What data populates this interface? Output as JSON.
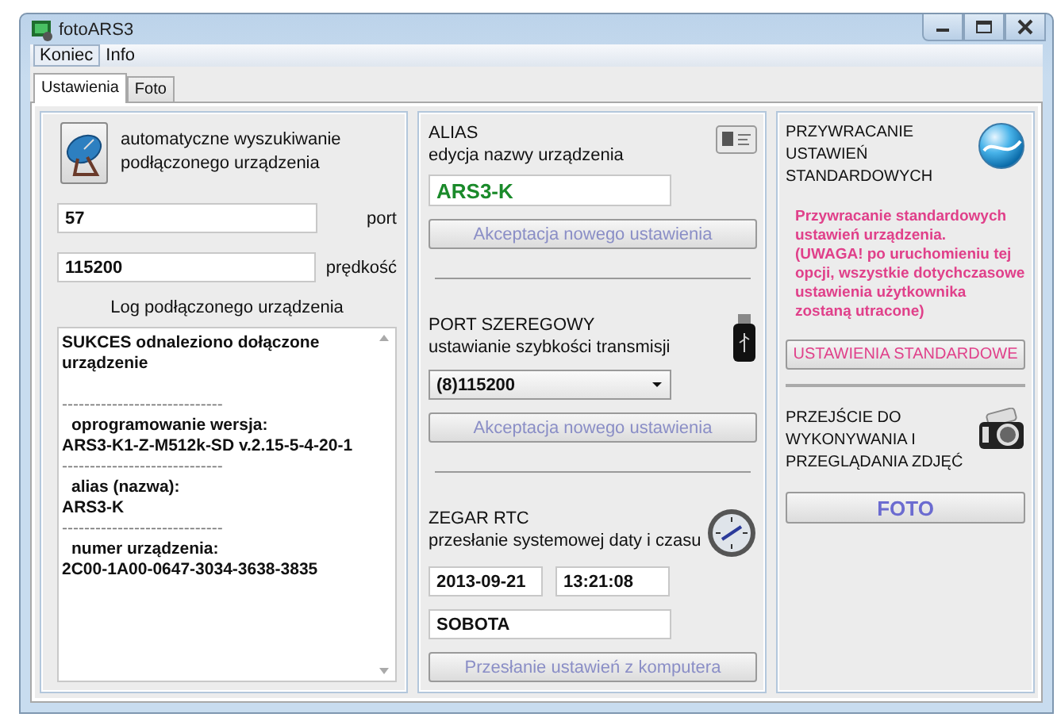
{
  "window": {
    "title": "fotoARS3"
  },
  "menu": [
    {
      "label": "Koniec",
      "selected": true
    },
    {
      "label": "Info",
      "selected": false
    }
  ],
  "tabs": [
    {
      "label": "Ustawienia",
      "selected": true
    },
    {
      "label": "Foto",
      "selected": false
    }
  ],
  "search_panel": {
    "description": "automatyczne wyszukiwanie podłączonego urządzenia",
    "port": {
      "value": "57",
      "label": "port"
    },
    "speed": {
      "value": "115200",
      "label": "prędkość"
    },
    "log_title": "Log podłączonego urządzenia",
    "log_lines": [
      {
        "kind": "message",
        "text": "SUKCES odnaleziono dołączone urządzenie"
      },
      {
        "kind": "separator",
        "text": "-----------------------------"
      },
      {
        "kind": "heading",
        "text": "oprogramowanie wersja:"
      },
      {
        "kind": "value",
        "text": "ARS3-K1-Z-M512k-SD v.2.15-5-4-20-1"
      },
      {
        "kind": "separator",
        "text": "-----------------------------"
      },
      {
        "kind": "heading",
        "text": "alias (nazwa):"
      },
      {
        "kind": "value",
        "text": "ARS3-K"
      },
      {
        "kind": "separator",
        "text": "-----------------------------"
      },
      {
        "kind": "heading",
        "text": "numer urządzenia:"
      },
      {
        "kind": "value",
        "text": "2C00-1A00-0647-3034-3638-3835"
      }
    ]
  },
  "alias": {
    "title": "ALIAS",
    "subtitle": "edycja nazwy urządzenia",
    "value": "ARS3-K",
    "button": "Akceptacja nowego ustawienia"
  },
  "serial_port": {
    "title": "PORT SZEREGOWY",
    "subtitle": "ustawianie szybkości transmisji",
    "value": "(8)115200",
    "button": "Akceptacja nowego ustawienia"
  },
  "clock": {
    "title": "ZEGAR RTC",
    "subtitle": "przesłanie systemowej daty i czasu",
    "date": "2013-09-21",
    "time": "13:21:08",
    "day": "SOBOTA",
    "button": "Przesłanie ustawień z komputera"
  },
  "reset": {
    "title": "PRZYWRACANIE USTAWIEŃ STANDARDOWYCH",
    "warning": [
      "Przywracanie standardowych ustawień urządzenia.",
      "(UWAGA! po uruchomieniu tej opcji, wszystkie dotychczasowe ustawienia użytkownika zostaną utracone)"
    ],
    "button": "USTAWIENIA STANDARDOWE"
  },
  "photo": {
    "title": "PRZEJŚCIE DO WYKONYWANIA I PRZEGLĄDANIA ZDJĘĆ",
    "button": "FOTO"
  }
}
